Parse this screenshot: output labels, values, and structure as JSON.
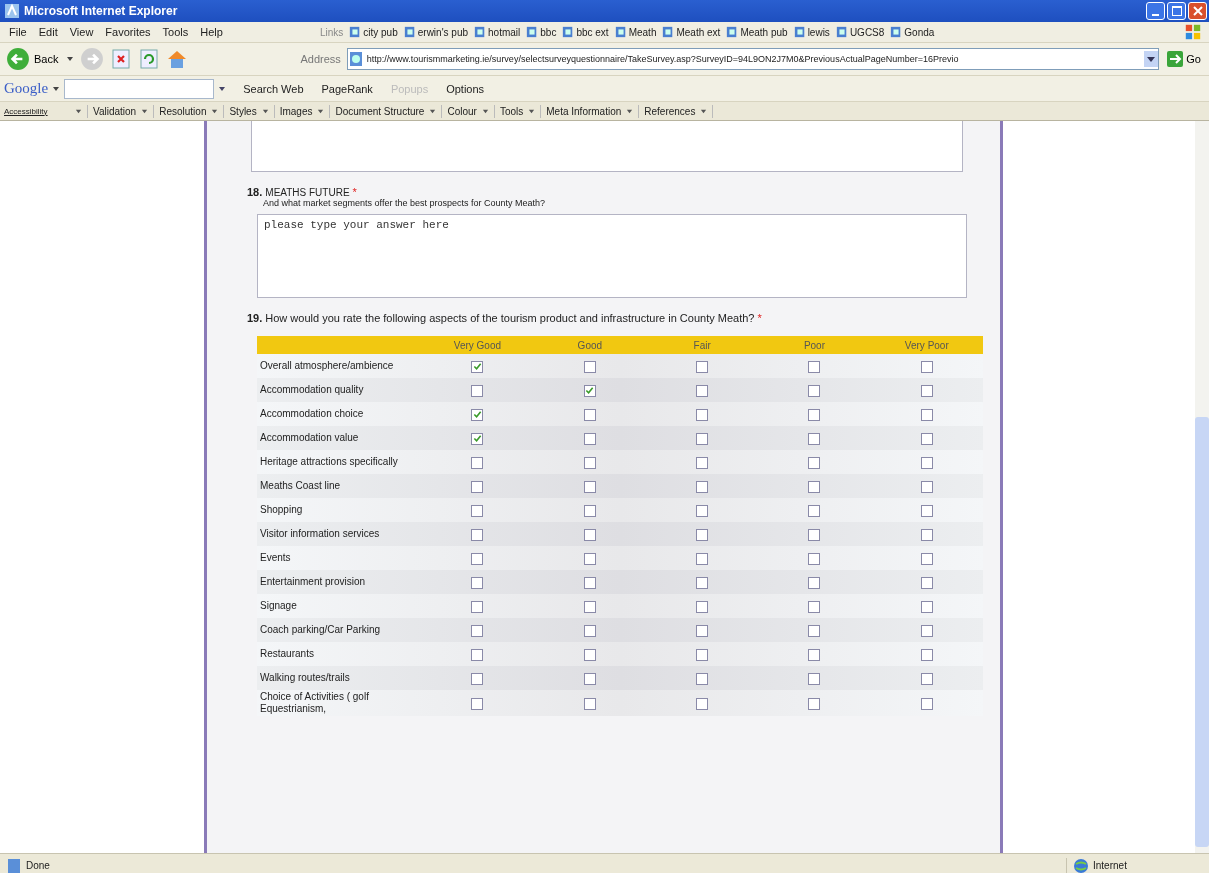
{
  "window": {
    "title": "Microsoft Internet Explorer"
  },
  "menu": [
    "File",
    "Edit",
    "View",
    "Favorites",
    "Tools",
    "Help"
  ],
  "links_label": "Links",
  "links": [
    "city pub",
    "erwin's pub",
    "hotmail",
    "bbc",
    "bbc ext",
    "Meath",
    "Meath ext",
    "Meath pub",
    "lewis",
    "UGCS8",
    "Gonda"
  ],
  "toolbar": {
    "back": "Back",
    "address_label": "Address",
    "address": "http://www.tourismmarketing.ie/survey/selectsurveyquestionnaire/TakeSurvey.asp?SurveyID=94L9ON2J7M0&PreviousActualPageNumber=16Previo",
    "go": "Go"
  },
  "google_bar": {
    "logo": "Google",
    "items": [
      {
        "label": "Search Web",
        "disabled": false
      },
      {
        "label": "PageRank",
        "disabled": false
      },
      {
        "label": "Popups",
        "disabled": true
      },
      {
        "label": "Options",
        "disabled": false
      }
    ]
  },
  "dev_bar": [
    "Accessibility",
    "Validation",
    "Resolution",
    "Styles",
    "Images",
    "Document Structure",
    "Colour",
    "Tools",
    "Meta Information",
    "References"
  ],
  "survey": {
    "q18": {
      "number": "18.",
      "title": "MEATHS FUTURE",
      "required": "*",
      "subtitle": "And what market segments offer the best prospects for County Meath?",
      "answer": "please type your answer here"
    },
    "q19": {
      "number": "19.",
      "text": "How would you rate the following aspects of the tourism product and infrastructure in County Meath?",
      "required": "*",
      "columns": [
        "Very Good",
        "Good",
        "Fair",
        "Poor",
        "Very Poor"
      ],
      "rows": [
        {
          "label": "Overall atmosphere/ambience",
          "checked": [
            true,
            false,
            false,
            false,
            false
          ]
        },
        {
          "label": "Accommodation quality",
          "checked": [
            false,
            true,
            false,
            false,
            false
          ]
        },
        {
          "label": "Accommodation choice",
          "checked": [
            true,
            false,
            false,
            false,
            false
          ]
        },
        {
          "label": "Accommodation value",
          "checked": [
            true,
            false,
            false,
            false,
            false
          ]
        },
        {
          "label": "Heritage attractions specifically",
          "checked": [
            false,
            false,
            false,
            false,
            false
          ]
        },
        {
          "label": "Meaths Coast line",
          "checked": [
            false,
            false,
            false,
            false,
            false
          ]
        },
        {
          "label": "Shopping",
          "checked": [
            false,
            false,
            false,
            false,
            false
          ]
        },
        {
          "label": "Visitor information services",
          "checked": [
            false,
            false,
            false,
            false,
            false
          ]
        },
        {
          "label": "Events",
          "checked": [
            false,
            false,
            false,
            false,
            false
          ]
        },
        {
          "label": "Entertainment provision",
          "checked": [
            false,
            false,
            false,
            false,
            false
          ]
        },
        {
          "label": "Signage",
          "checked": [
            false,
            false,
            false,
            false,
            false
          ]
        },
        {
          "label": "Coach parking/Car Parking",
          "checked": [
            false,
            false,
            false,
            false,
            false
          ]
        },
        {
          "label": "Restaurants",
          "checked": [
            false,
            false,
            false,
            false,
            false
          ]
        },
        {
          "label": "Walking routes/trails",
          "checked": [
            false,
            false,
            false,
            false,
            false
          ]
        },
        {
          "label": "Choice of Activities ( golf Equestrianism,",
          "checked": [
            false,
            false,
            false,
            false,
            false
          ]
        }
      ]
    }
  },
  "status_bar": {
    "left": "Done",
    "right": "Internet"
  }
}
